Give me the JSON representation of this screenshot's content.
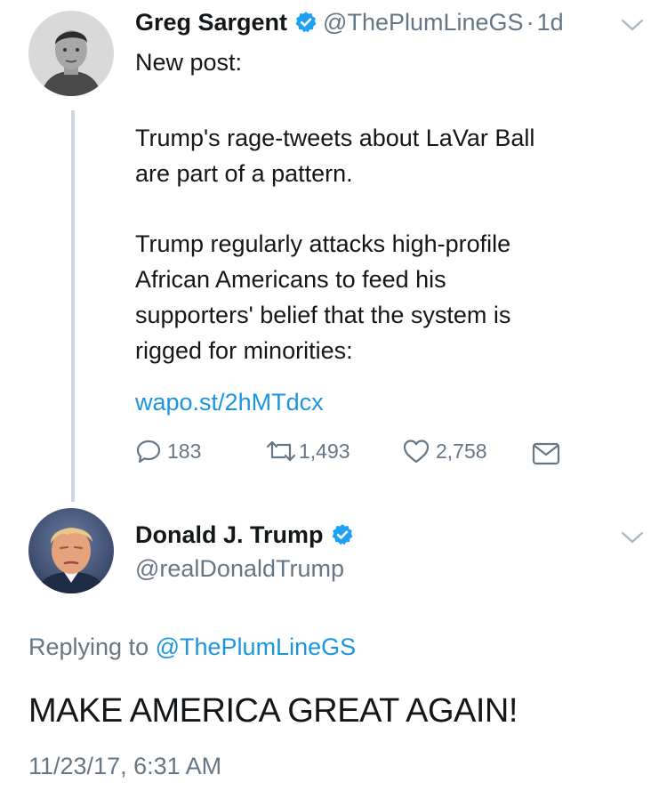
{
  "tweet1": {
    "author_name": "Greg Sargent",
    "handle": "@ThePlumLineGS",
    "separator": "·",
    "age": "1d",
    "lines": [
      "New post:",
      "",
      "Trump's rage-tweets about LaVar Ball",
      "are part of a pattern.",
      "",
      "Trump regularly attacks high-profile",
      "African Americans to feed his",
      "supporters' belief that the system is",
      "rigged for minorities:"
    ],
    "link": "wapo.st/2hMTdcx",
    "replies": "183",
    "retweets": "1,493",
    "likes": "2,758",
    "verified": true
  },
  "tweet2": {
    "author_name": "Donald J. Trump",
    "handle": "@realDonaldTrump",
    "verified": true,
    "replying_prefix": "Replying to",
    "replying_handle": "@ThePlumLineGS",
    "text": "MAKE AMERICA GREAT AGAIN!",
    "timestamp": "11/23/17, 6:31 AM"
  },
  "colors": {
    "link": "#1b95e0",
    "secondary": "#657786",
    "verified": "#1da1f2",
    "thread_line": "#cfd9de"
  },
  "icons": [
    "reply-icon",
    "retweet-icon",
    "like-icon",
    "dm-icon",
    "verified-icon",
    "chevron-down-icon"
  ]
}
